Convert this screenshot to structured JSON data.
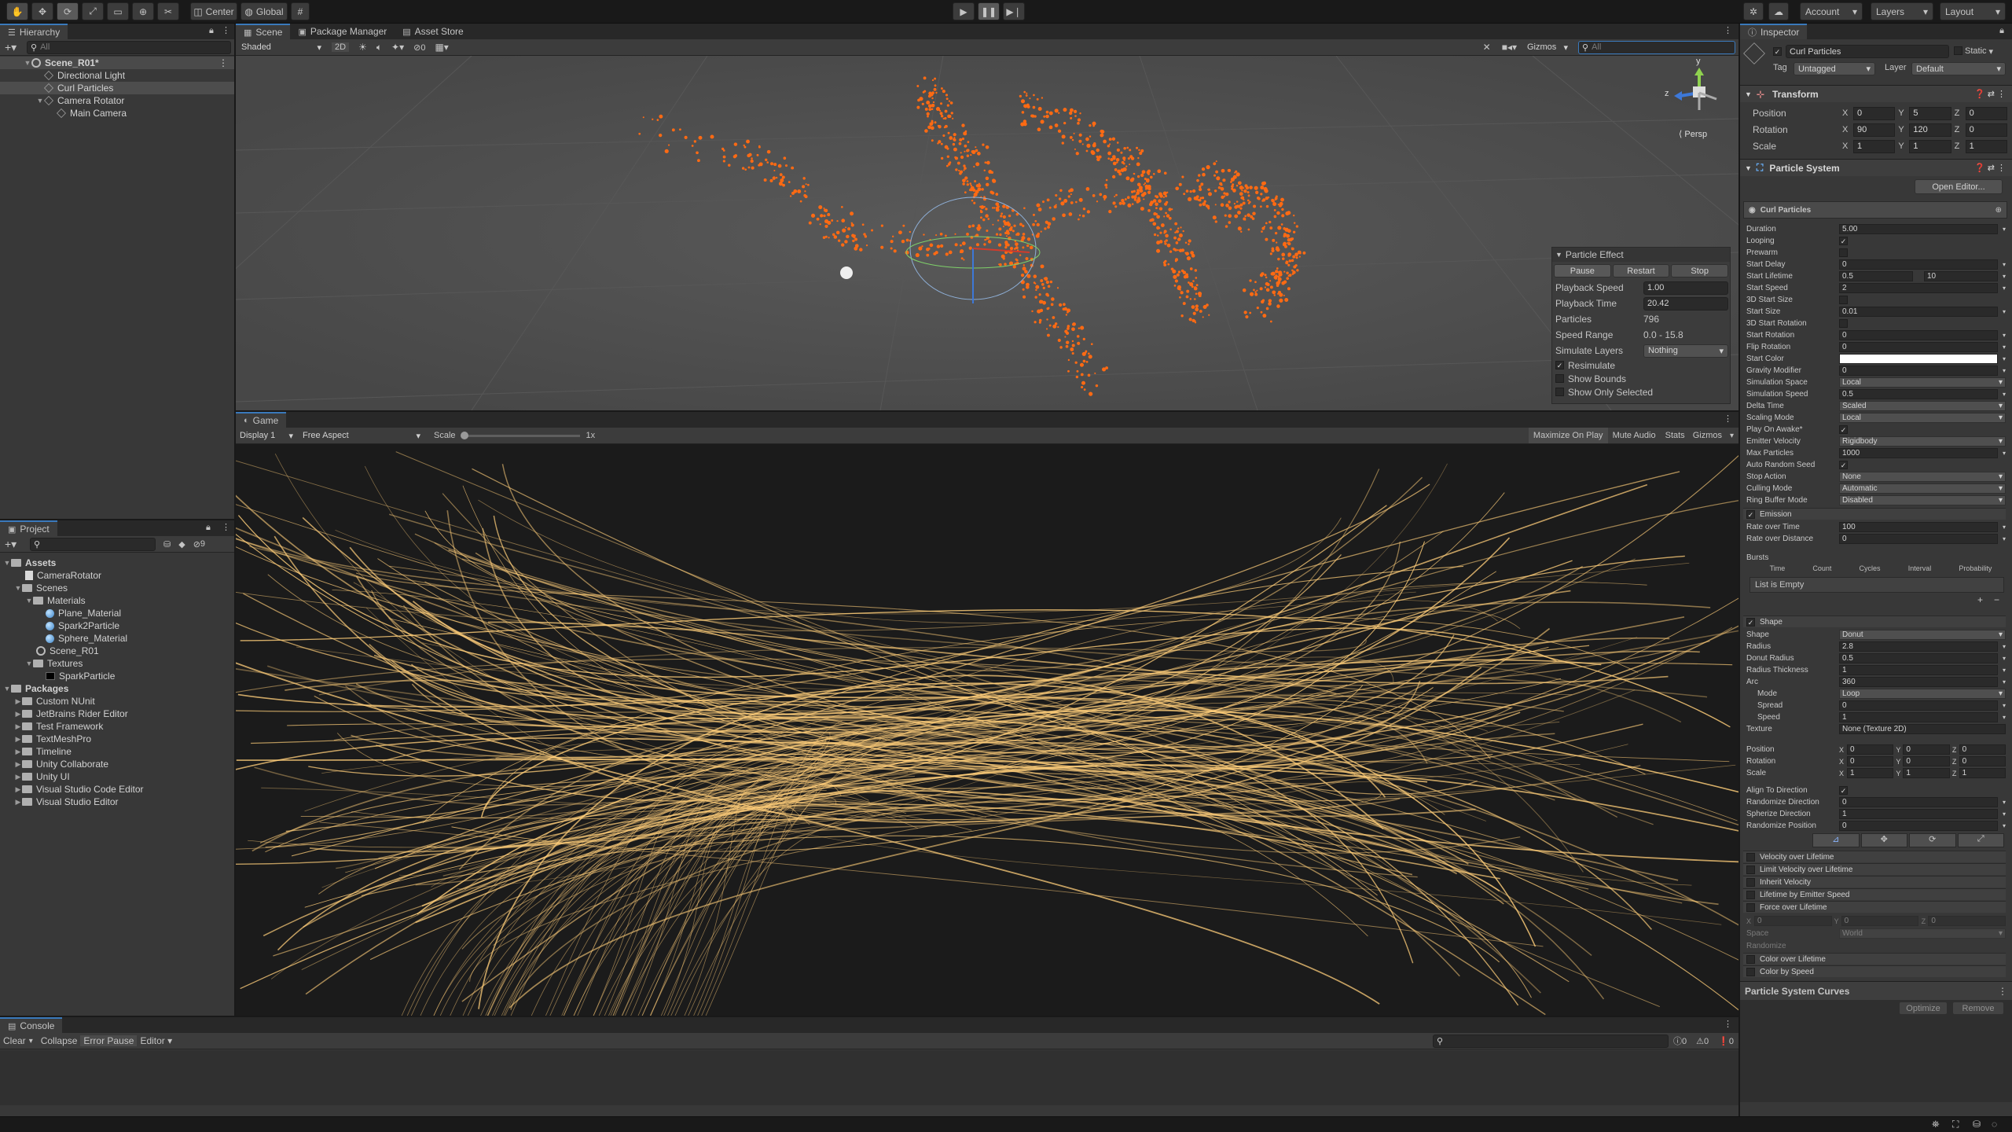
{
  "toolbar": {
    "center_label": "Center",
    "global_label": "Global",
    "account_label": "Account",
    "layers_label": "Layers",
    "layout_label": "Layout"
  },
  "hierarchy": {
    "tab_label": "Hierarchy",
    "search_placeholder": "All",
    "items": [
      {
        "label": "Scene_R01*"
      },
      {
        "label": "Directional Light"
      },
      {
        "label": "Curl Particles"
      },
      {
        "label": "Camera Rotator"
      },
      {
        "label": "Main Camera"
      }
    ]
  },
  "scene": {
    "tabs": [
      {
        "label": "Scene"
      },
      {
        "label": "Package Manager"
      },
      {
        "label": "Asset Store"
      }
    ],
    "shading_mode": "Shaded",
    "mode_2d": "2D",
    "hidden_count": "0",
    "gizmos_label": "Gizmos",
    "search_placeholder": "All",
    "persp_label": "Persp",
    "gizmo_axes": {
      "y": "y",
      "z": "z"
    },
    "particle_effect": {
      "title": "Particle Effect",
      "pause": "Pause",
      "restart": "Restart",
      "stop": "Stop",
      "rows": [
        {
          "label": "Playback Speed",
          "value": "1.00"
        },
        {
          "label": "Playback Time",
          "value": "20.42"
        },
        {
          "label": "Particles",
          "value": "796"
        },
        {
          "label": "Speed Range",
          "value": "0.0 - 15.8"
        },
        {
          "label": "Simulate Layers",
          "value": "Nothing"
        }
      ],
      "resimulate": "Resimulate",
      "show_bounds": "Show Bounds",
      "show_only_selected": "Show Only Selected"
    }
  },
  "game": {
    "tab_label": "Game",
    "display": "Display 1",
    "aspect": "Free Aspect",
    "scale_label": "Scale",
    "scale_value": "1x",
    "maximize": "Maximize On Play",
    "mute": "Mute Audio",
    "stats": "Stats",
    "gizmos": "Gizmos"
  },
  "project": {
    "tab_label": "Project",
    "hidden_count": "9",
    "items": [
      {
        "label": "Assets"
      },
      {
        "label": "CameraRotator"
      },
      {
        "label": "Scenes"
      },
      {
        "label": "Materials"
      },
      {
        "label": "Plane_Material"
      },
      {
        "label": "Spark2Particle"
      },
      {
        "label": "Sphere_Material"
      },
      {
        "label": "Scene_R01"
      },
      {
        "label": "Textures"
      },
      {
        "label": "SparkParticle"
      },
      {
        "label": "Packages"
      },
      {
        "label": "Custom NUnit"
      },
      {
        "label": "JetBrains Rider Editor"
      },
      {
        "label": "Test Framework"
      },
      {
        "label": "TextMeshPro"
      },
      {
        "label": "Timeline"
      },
      {
        "label": "Unity Collaborate"
      },
      {
        "label": "Unity UI"
      },
      {
        "label": "Visual Studio Code Editor"
      },
      {
        "label": "Visual Studio Editor"
      }
    ]
  },
  "console": {
    "tab_label": "Console",
    "clear": "Clear",
    "collapse": "Collapse",
    "error_pause": "Error Pause",
    "editor": "Editor",
    "log_count": "0",
    "warn_count": "0",
    "err_count": "0"
  },
  "inspector": {
    "tab_label": "Inspector",
    "object_name": "Curl Particles",
    "static_label": "Static",
    "tag_label": "Tag",
    "tag_value": "Untagged",
    "layer_label": "Layer",
    "layer_value": "Default",
    "transform": {
      "title": "Transform",
      "position_label": "Position",
      "rotation_label": "Rotation",
      "scale_label": "Scale",
      "position": {
        "x": "0",
        "y": "5",
        "z": "0"
      },
      "rotation": {
        "x": "90",
        "y": "120",
        "z": "0"
      },
      "scale": {
        "x": "1",
        "y": "1",
        "z": "1"
      }
    },
    "particle_system": {
      "title": "Particle System",
      "open_editor": "Open Editor...",
      "module_name": "Curl Particles",
      "main": [
        {
          "label": "Duration",
          "value": "5.00",
          "kind": "val"
        },
        {
          "label": "Looping",
          "value": "✓",
          "kind": "chk"
        },
        {
          "label": "Prewarm",
          "value": "",
          "kind": "chk"
        },
        {
          "label": "Start Delay",
          "value": "0",
          "kind": "val"
        },
        {
          "label": "Start Lifetime",
          "value": "0.5",
          "value2": "10",
          "kind": "val2"
        },
        {
          "label": "Start Speed",
          "value": "2",
          "kind": "val"
        },
        {
          "label": "3D Start Size",
          "value": "",
          "kind": "chk"
        },
        {
          "label": "Start Size",
          "value": "0.01",
          "kind": "val"
        },
        {
          "label": "3D Start Rotation",
          "value": "",
          "kind": "chk"
        },
        {
          "label": "Start Rotation",
          "value": "0",
          "kind": "val"
        },
        {
          "label": "Flip Rotation",
          "value": "0",
          "kind": "val"
        },
        {
          "label": "Start Color",
          "value": "",
          "kind": "color"
        },
        {
          "label": "Gravity Modifier",
          "value": "0",
          "kind": "val"
        },
        {
          "label": "Simulation Space",
          "value": "Local",
          "kind": "dd"
        },
        {
          "label": "Simulation Speed",
          "value": "0.5",
          "kind": "val"
        },
        {
          "label": "Delta Time",
          "value": "Scaled",
          "kind": "dd"
        },
        {
          "label": "Scaling Mode",
          "value": "Local",
          "kind": "dd"
        },
        {
          "label": "Play On Awake*",
          "value": "✓",
          "kind": "chk"
        },
        {
          "label": "Emitter Velocity",
          "value": "Rigidbody",
          "kind": "dd"
        },
        {
          "label": "Max Particles",
          "value": "1000",
          "kind": "val"
        },
        {
          "label": "Auto Random Seed",
          "value": "✓",
          "kind": "chk"
        },
        {
          "label": "Stop Action",
          "value": "None",
          "kind": "dd"
        },
        {
          "label": "Culling Mode",
          "value": "Automatic",
          "kind": "dd"
        },
        {
          "label": "Ring Buffer Mode",
          "value": "Disabled",
          "kind": "dd"
        }
      ],
      "emission": {
        "title": "Emission",
        "rate_time_label": "Rate over Time",
        "rate_time": "100",
        "rate_dist_label": "Rate over Distance",
        "rate_dist": "0",
        "bursts": "Bursts",
        "cols": [
          "Time",
          "Count",
          "Cycles",
          "Interval",
          "Probability"
        ],
        "empty": "List is Empty"
      },
      "shape": {
        "title": "Shape",
        "rows": [
          {
            "label": "Shape",
            "value": "Donut",
            "kind": "dd"
          },
          {
            "label": "Radius",
            "value": "2.8",
            "kind": "val"
          },
          {
            "label": "Donut Radius",
            "value": "0.5",
            "kind": "val"
          },
          {
            "label": "Radius Thickness",
            "value": "1",
            "kind": "val"
          },
          {
            "label": "Arc",
            "value": "360",
            "kind": "val"
          },
          {
            "label": "Mode",
            "value": "Loop",
            "kind": "dd",
            "indent": true
          },
          {
            "label": "Spread",
            "value": "0",
            "kind": "val",
            "indent": true
          },
          {
            "label": "Speed",
            "value": "1",
            "kind": "val",
            "indent": true
          },
          {
            "label": "Texture",
            "value": "None (Texture 2D)",
            "kind": "obj"
          }
        ],
        "position_label": "Position",
        "rotation_label": "Rotation",
        "scale_label": "Scale",
        "position": [
          "0",
          "0",
          "0"
        ],
        "rotation": [
          "0",
          "0",
          "0"
        ],
        "scale": [
          "1",
          "1",
          "1"
        ],
        "rows2": [
          {
            "label": "Align To Direction",
            "value": "✓",
            "kind": "chk"
          },
          {
            "label": "Randomize Direction",
            "value": "0",
            "kind": "val"
          },
          {
            "label": "Spherize Direction",
            "value": "1",
            "kind": "val"
          },
          {
            "label": "Randomize Position",
            "value": "0",
            "kind": "val"
          }
        ]
      },
      "modules": [
        "Velocity over Lifetime",
        "Limit Velocity over Lifetime",
        "Inherit Velocity",
        "Lifetime by Emitter Speed",
        "Force over Lifetime"
      ],
      "force": {
        "space_label": "Space",
        "space": "World",
        "randomize": "Randomize",
        "x": "0",
        "y": "0",
        "z": "0"
      },
      "modules2": [
        "Color over Lifetime",
        "Color by Speed"
      ],
      "curves_title": "Particle System Curves",
      "optimize": "Optimize",
      "remove": "Remove"
    }
  },
  "colors": {
    "accent": "#3a79bb",
    "particle_scene": "#ff6a13",
    "particle_game": "#ffce7a"
  }
}
